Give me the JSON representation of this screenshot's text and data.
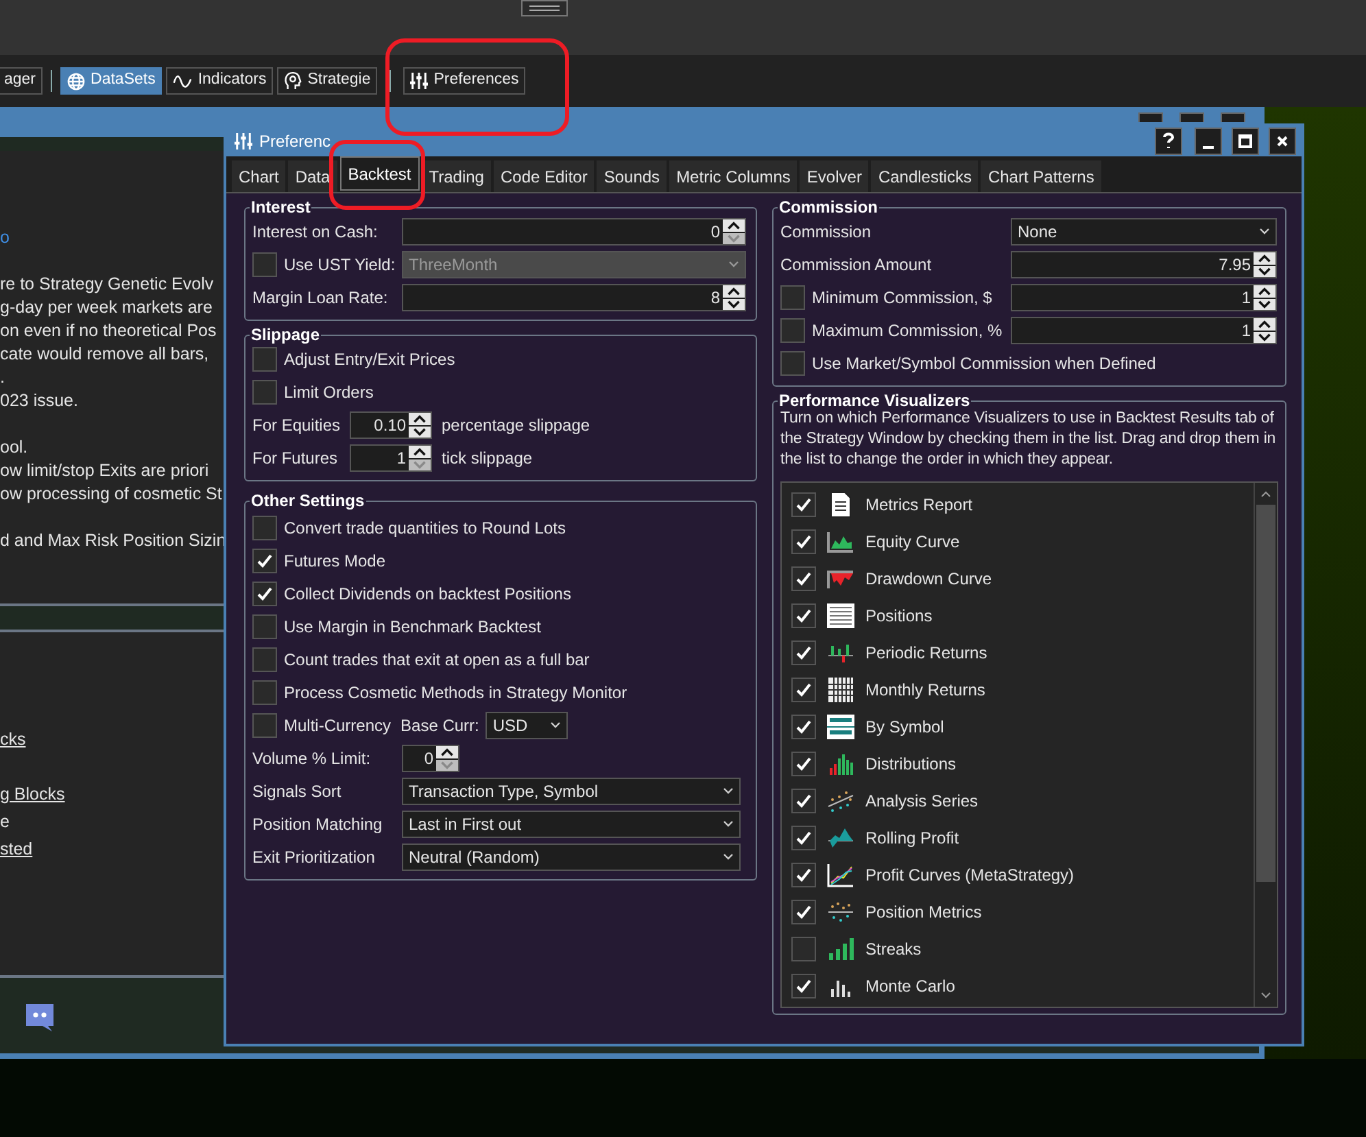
{
  "toolbar": {
    "buttons": [
      {
        "label": "ager",
        "kind": "plain",
        "selected": false
      },
      {
        "label": "DataSets",
        "kind": "globe",
        "selected": true
      },
      {
        "label": "Indicators",
        "kind": "wave",
        "selected": false
      },
      {
        "label": "Strategie",
        "kind": "head",
        "selected": false
      },
      {
        "label": "Preferences",
        "kind": "sliders",
        "selected": false
      }
    ]
  },
  "background_window": {
    "upper_paragraphs": [
      [
        {
          "text": "o",
          "kind": "link"
        }
      ],
      [
        {
          "text": "re to Strategy Genetic Evolv",
          "kind": "text"
        },
        {
          "text": "g-day per week markets are",
          "kind": "text"
        },
        {
          "text": "on even if no theoretical Pos",
          "kind": "text"
        },
        {
          "text": "cate would remove all bars,",
          "kind": "text"
        },
        {
          "text": ".",
          "kind": "text"
        },
        {
          "text": "023 issue.",
          "kind": "text"
        }
      ],
      [
        {
          "text": "ool.",
          "kind": "text"
        },
        {
          "text": "ow limit/stop Exits are priori",
          "kind": "text"
        },
        {
          "text": "ow processing of cosmetic St",
          "kind": "text"
        }
      ],
      [
        {
          "text": "d and Max Risk Position Sizin",
          "kind": "text"
        }
      ]
    ],
    "lower_lines": [
      {
        "text": "cks",
        "kind": "link"
      },
      {
        "text": "g Blocks",
        "kind": "link"
      },
      {
        "text": "e",
        "kind": "text"
      },
      {
        "text": "sted",
        "kind": "link"
      }
    ]
  },
  "preferences_window": {
    "title": "Preferenc",
    "tabs": [
      {
        "label": "Chart",
        "selected": false
      },
      {
        "label": "Data",
        "selected": false
      },
      {
        "label": "Backtest",
        "selected": true
      },
      {
        "label": "Trading",
        "selected": false
      },
      {
        "label": "Code Editor",
        "selected": false
      },
      {
        "label": "Sounds",
        "selected": false
      },
      {
        "label": "Metric Columns",
        "selected": false
      },
      {
        "label": "Evolver",
        "selected": false
      },
      {
        "label": "Candlesticks",
        "selected": false
      },
      {
        "label": "Chart Patterns",
        "selected": false
      }
    ],
    "left_groups": [
      {
        "title": "Interest",
        "rows": [
          {
            "kind": "spin",
            "label": "Interest on Cash:",
            "value": "0",
            "down_disabled": true
          },
          {
            "kind": "check_select",
            "label": "Use UST Yield:",
            "checked": false,
            "value": "ThreeMonth",
            "disabled": true
          },
          {
            "kind": "spin",
            "label": "Margin Loan Rate:",
            "value": "8",
            "down_disabled": false
          }
        ]
      },
      {
        "title": "Slippage",
        "rows": [
          {
            "kind": "check",
            "label": "Adjust Entry/Exit Prices",
            "checked": false
          },
          {
            "kind": "check",
            "label": "Limit Orders",
            "checked": false
          },
          {
            "kind": "small_spin",
            "label": "For Equities",
            "value": "0.10",
            "down_disabled": false,
            "suffix": "percentage slippage"
          },
          {
            "kind": "small_spin",
            "label": "For Futures",
            "value": "1",
            "down_disabled": true,
            "suffix": "tick slippage"
          }
        ]
      },
      {
        "title": "Other Settings",
        "rows": [
          {
            "kind": "check",
            "label": "Convert trade quantities to Round Lots",
            "checked": false
          },
          {
            "kind": "check",
            "label": "Futures Mode",
            "checked": true
          },
          {
            "kind": "check",
            "label": "Collect Dividends on backtest Positions",
            "checked": true
          },
          {
            "kind": "check",
            "label": "Use Margin in Benchmark Backtest",
            "checked": false
          },
          {
            "kind": "check",
            "label": "Count trades that exit at open as a full bar",
            "checked": false
          },
          {
            "kind": "check",
            "label": "Process Cosmetic Methods in Strategy Monitor",
            "checked": false
          },
          {
            "kind": "check_currency",
            "label": "Multi-Currency",
            "checked": false,
            "currency_label": "Base Curr:",
            "currency": "USD"
          },
          {
            "kind": "short_spin",
            "label": "Volume % Limit:",
            "value": "0",
            "down_disabled": true
          },
          {
            "kind": "select",
            "label": "Signals Sort",
            "value": "Transaction Type, Symbol"
          },
          {
            "kind": "select",
            "label": "Position Matching",
            "value": "Last in First out"
          },
          {
            "kind": "select",
            "label": "Exit Prioritization",
            "value": "Neutral (Random)"
          }
        ]
      }
    ],
    "commission": {
      "title": "Commission",
      "rows": [
        {
          "kind": "select",
          "label": "Commission",
          "value": "None"
        },
        {
          "kind": "spin",
          "label": "Commission Amount",
          "value": "7.95",
          "down_disabled": false
        },
        {
          "kind": "check_spin",
          "label": "Minimum Commission, $",
          "checked": false,
          "value": "1",
          "down_disabled": false
        },
        {
          "kind": "check_spin",
          "label": "Maximum Commission, %",
          "checked": false,
          "value": "1",
          "down_disabled": false
        },
        {
          "kind": "check",
          "label": "Use Market/Symbol Commission when Defined",
          "checked": false
        }
      ]
    },
    "performance_visualizers": {
      "title": "Performance Visualizers",
      "description": "Turn on which Performance Visualizers to use in Backtest Results tab of the Strategy Window by checking them in the list. Drag and drop them in the list to change the order in which they appear.",
      "items": [
        {
          "label": "Metrics Report",
          "checked": true,
          "kind": "document"
        },
        {
          "label": "Equity Curve",
          "checked": true,
          "kind": "equity"
        },
        {
          "label": "Drawdown Curve",
          "checked": true,
          "kind": "drawdown"
        },
        {
          "label": "Positions",
          "checked": true,
          "kind": "table"
        },
        {
          "label": "Periodic Returns",
          "checked": true,
          "kind": "periodic"
        },
        {
          "label": "Monthly Returns",
          "checked": true,
          "kind": "grid"
        },
        {
          "label": "By Symbol",
          "checked": true,
          "kind": "symbol"
        },
        {
          "label": "Distributions",
          "checked": true,
          "kind": "distribution"
        },
        {
          "label": "Analysis Series",
          "checked": true,
          "kind": "scatter"
        },
        {
          "label": "Rolling Profit",
          "checked": true,
          "kind": "rolling"
        },
        {
          "label": "Profit Curves (MetaStrategy)",
          "checked": true,
          "kind": "curves"
        },
        {
          "label": "Position Metrics",
          "checked": true,
          "kind": "dots"
        },
        {
          "label": "Streaks",
          "checked": false,
          "kind": "streaks"
        },
        {
          "label": "Monte Carlo",
          "checked": true,
          "kind": "monte"
        }
      ]
    }
  }
}
